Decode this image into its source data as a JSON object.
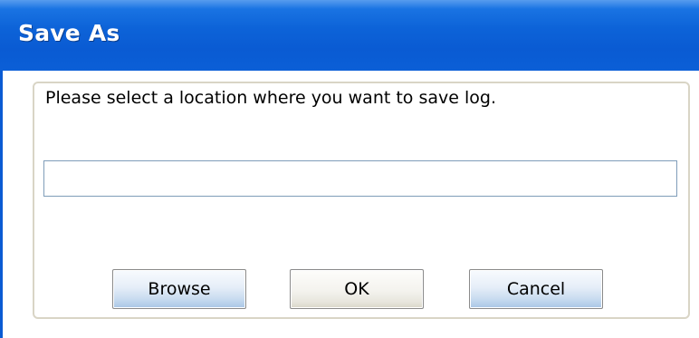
{
  "window": {
    "title": "Save As"
  },
  "dialog": {
    "prompt": "Please select a location where you want to save log.",
    "path_value": "",
    "buttons": {
      "browse": "Browse",
      "ok": "OK",
      "cancel": "Cancel"
    }
  },
  "colors": {
    "titlebar": "#0a5bd3",
    "title_text": "#ffffff",
    "group_border": "#d9d5c6",
    "input_border": "#7f9db9"
  }
}
